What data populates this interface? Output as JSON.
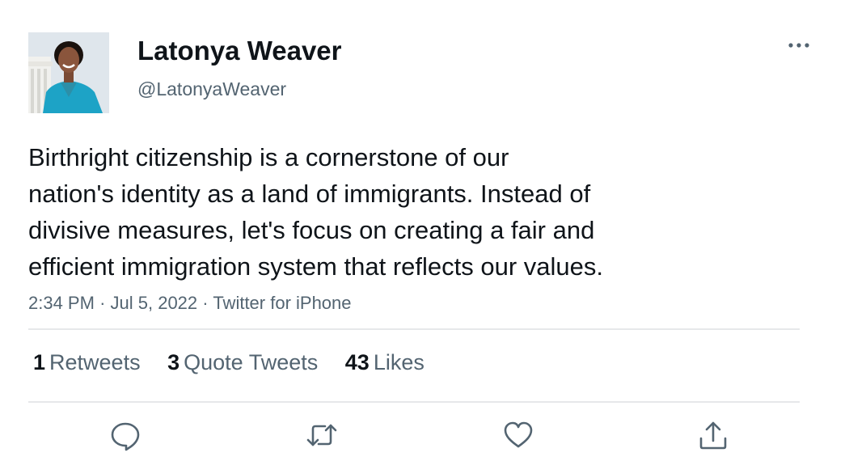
{
  "author": {
    "display_name": "Latonya Weaver",
    "handle": "@LatonyaWeaver",
    "avatar_icon": "profile-photo"
  },
  "tweet": {
    "text_lines": [
      "Birthright citizenship is a cornerstone of our",
      "nation's identity as a land of immigrants. Instead of",
      "divisive measures, let's focus on creating a fair and",
      "efficient immigration system that reflects our values."
    ],
    "time": "2:34 PM",
    "separator": "·",
    "date": "Jul 5, 2022",
    "source": "Twitter for iPhone"
  },
  "stats": {
    "retweets_count": "1",
    "retweets_label": "Retweets",
    "quotes_count": "3",
    "quotes_label": "Quote Tweets",
    "likes_count": "43",
    "likes_label": "Likes"
  },
  "actions": [
    {
      "icon": "reply-icon"
    },
    {
      "icon": "retweet-icon"
    },
    {
      "icon": "like-icon"
    },
    {
      "icon": "share-icon"
    }
  ],
  "colors": {
    "text_primary": "#0f1419",
    "text_secondary": "#536471",
    "divider": "#e6e8ea",
    "icon": "#536471"
  }
}
